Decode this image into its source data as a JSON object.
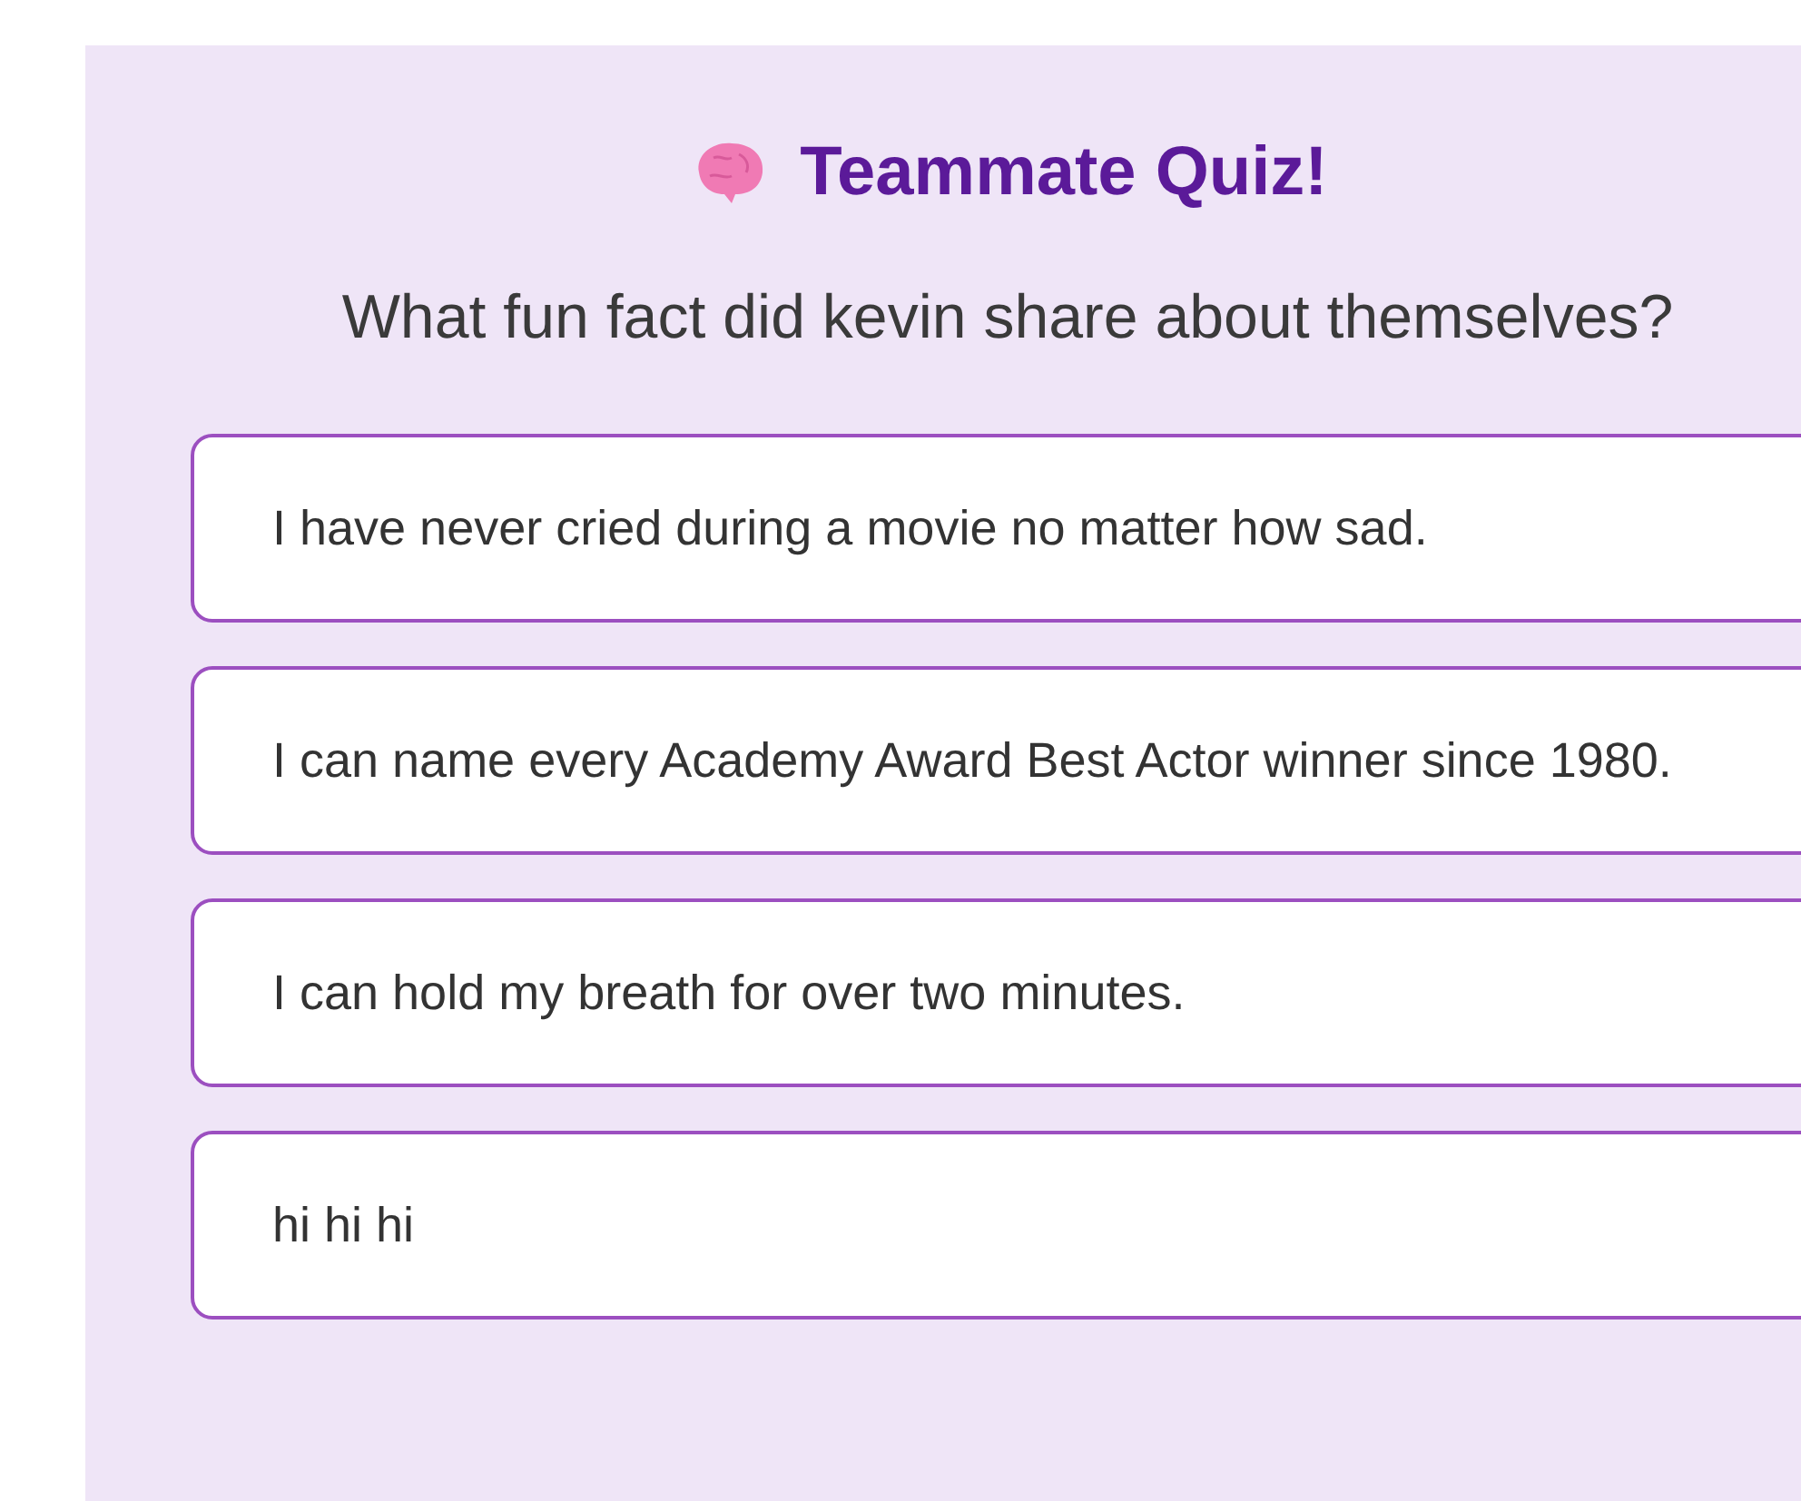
{
  "title": "Teammate Quiz!",
  "question": "What fun fact did kevin share about themselves?",
  "options": [
    {
      "text": "I have never cried during a movie no matter how sad."
    },
    {
      "text": "I can name every Academy Award Best Actor winner since 1980."
    },
    {
      "text": "I can hold my breath for over two minutes."
    },
    {
      "text": "hi hi hi"
    }
  ]
}
